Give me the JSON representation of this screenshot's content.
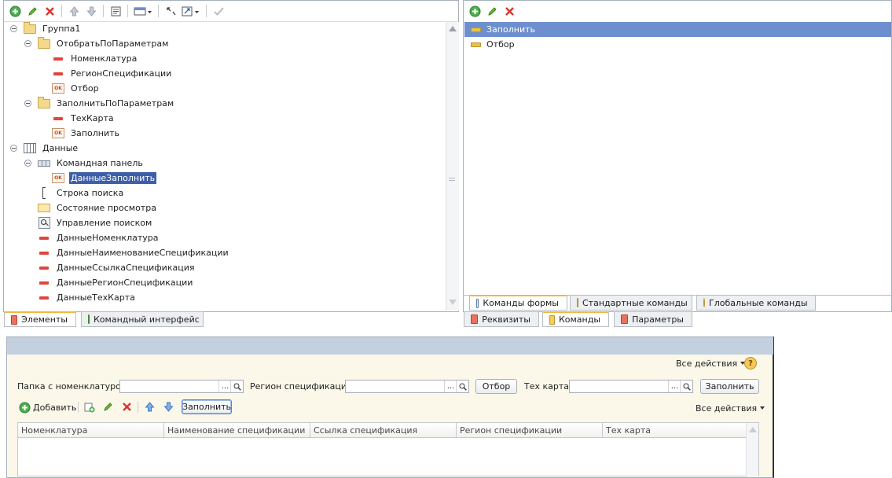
{
  "elements_tree": {
    "items": [
      {
        "label": "Группа1",
        "icon": "folder-icon",
        "expander": true
      },
      {
        "label": "ОтобратьПоПараметрам",
        "icon": "folder-icon",
        "expander": true
      },
      {
        "label": "Номенклатура",
        "icon": "field-icon"
      },
      {
        "label": "РегионСпецификации",
        "icon": "field-icon"
      },
      {
        "label": "Отбор",
        "icon": "button-ok-icon"
      },
      {
        "label": "ЗаполнитьПоПараметрам",
        "icon": "folder-icon",
        "expander": true
      },
      {
        "label": "ТехКарта",
        "icon": "field-icon"
      },
      {
        "label": "Заполнить",
        "icon": "button-ok-icon"
      },
      {
        "label": "Данные",
        "icon": "table-icon",
        "expander": true
      },
      {
        "label": "Командная панель",
        "icon": "command-bar-icon",
        "expander": true
      },
      {
        "label": "ДанныеЗаполнить",
        "icon": "button-ok-icon",
        "selected": true
      },
      {
        "label": "Строка поиска",
        "icon": "search-string-icon"
      },
      {
        "label": "Состояние просмотра",
        "icon": "view-state-icon"
      },
      {
        "label": "Управление поиском",
        "icon": "search-control-icon"
      },
      {
        "label": "ДанныеНоменклатура",
        "icon": "field-icon"
      },
      {
        "label": "ДанныеНаименованиеСпецификации",
        "icon": "field-icon"
      },
      {
        "label": "ДанныеСсылкаСпецификация",
        "icon": "field-icon"
      },
      {
        "label": "ДанныеРегионСпецификации",
        "icon": "field-icon"
      },
      {
        "label": "ДанныеТехКарта",
        "icon": "field-icon"
      }
    ],
    "bottom_tabs": [
      {
        "label": "Элементы",
        "active": true
      },
      {
        "label": "Командный интерфейс",
        "active": false
      }
    ]
  },
  "commands_list": {
    "items": [
      {
        "label": "Заполнить",
        "selected": true
      },
      {
        "label": "Отбор",
        "selected": false
      }
    ],
    "inner_tabs": [
      {
        "label": "Команды формы",
        "active": true
      },
      {
        "label": "Стандартные команды",
        "active": false
      },
      {
        "label": "Глобальные команды",
        "active": false
      }
    ],
    "bottom_tabs": [
      {
        "label": "Реквизиты",
        "active": false
      },
      {
        "label": "Команды",
        "active": true
      },
      {
        "label": "Параметры",
        "active": false
      }
    ]
  },
  "form_preview": {
    "all_actions_top": "Все действия",
    "all_actions_grid": "Все действия",
    "help": "?",
    "fields": {
      "folder_label": "Папка с номенклатурой:",
      "region_label": "Регион спецификации:",
      "techcard_label": "Тех карта:",
      "folder_value": "",
      "region_value": "",
      "techcard_value": "",
      "ellipsis": "...",
      "filter_button": "Отбор",
      "fill_button": "Заполнить"
    },
    "grid_toolbar": {
      "add_button": "Добавить",
      "fill_button": "Заполнить"
    },
    "columns": [
      "Номенклатура",
      "Наименование спецификации",
      "Ссылка спецификация",
      "Регион спецификации",
      "Тех карта"
    ]
  },
  "colors": {
    "selection": "#3e5fa8",
    "form_background": "#fbf8ea",
    "form_title": "#c2d0e0"
  }
}
